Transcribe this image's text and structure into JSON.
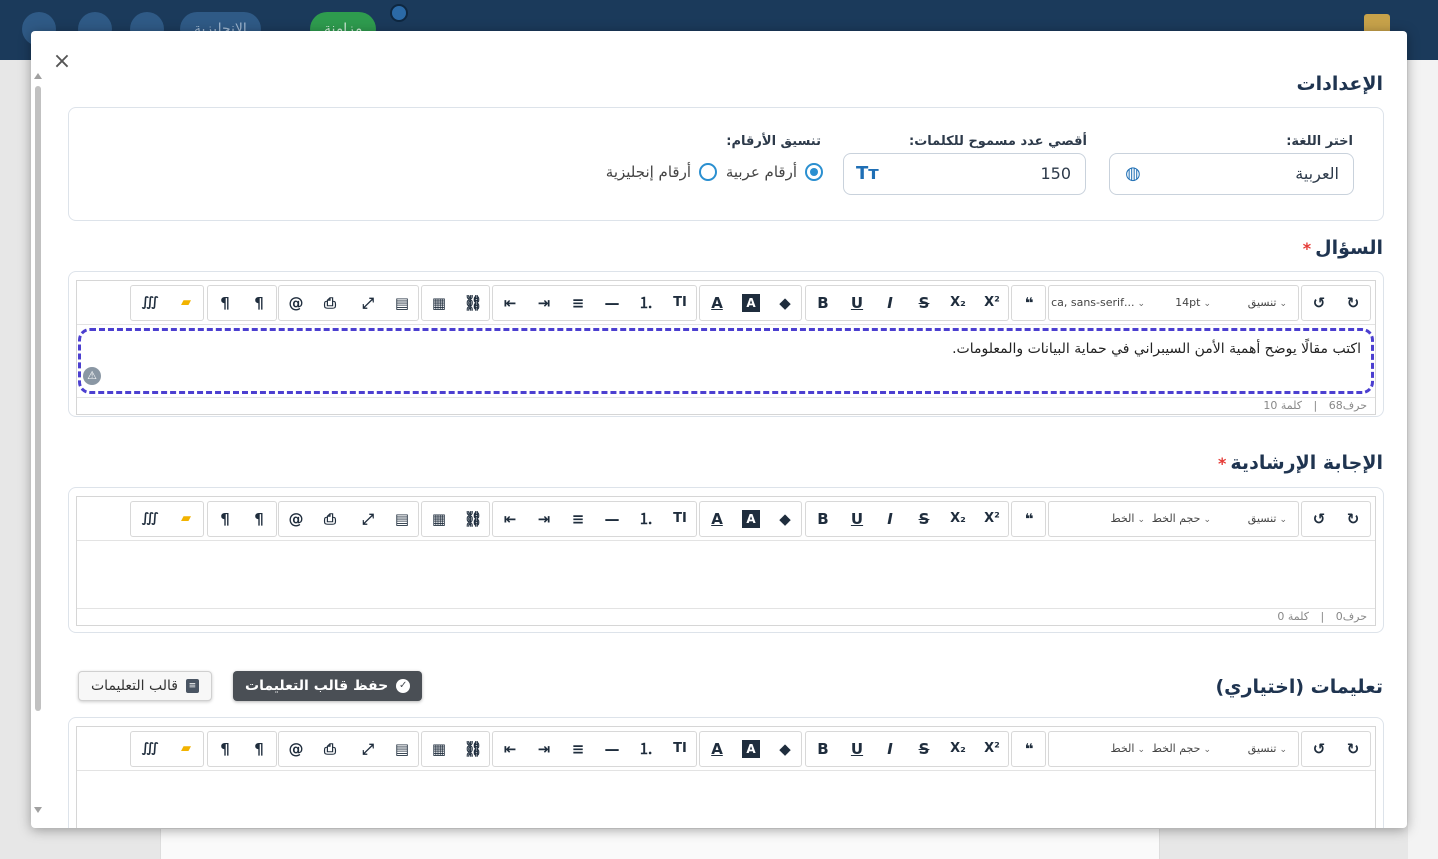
{
  "topbar": {
    "english_pill": "الإنجليزية",
    "sync_pill": "مزامنة"
  },
  "modal": {
    "close_icon": "×",
    "settings_title": "الإعدادات",
    "language": {
      "label": "اختر اللغة:",
      "value": "العربية"
    },
    "max_words": {
      "label": "أقصي عدد مسموح للكلمات:",
      "value": "150"
    },
    "number_format": {
      "label": "تنسيق الأرقام:",
      "options": [
        {
          "label": "أرقام عربية",
          "selected": true
        },
        {
          "label": "أرقام إنجليزية",
          "selected": false
        }
      ]
    },
    "question": {
      "title": "السؤال",
      "required_mark": "*",
      "font_select": "...ca, sans-serif",
      "size_select": "14pt",
      "format_select": "تنسيق",
      "content": "اكتب مقالًا يوضح أهمية الأمن السيبراني في حماية البيانات والمعلومات.",
      "char_count": "حرف68",
      "word_count": "كلمة 10"
    },
    "guide_answer": {
      "title": "الإجابة الإرشادية",
      "required_mark": "*",
      "font_select": "الخط",
      "size_select": "حجم الخط",
      "format_select": "تنسيق",
      "char_count": "حرف0",
      "word_count": "كلمة 0"
    },
    "instructions": {
      "title": "تعليمات (اختياري)",
      "save_template_button": "حفظ قالب التعليمات",
      "template_button": "قالب التعليمات",
      "font_select": "الخط",
      "size_select": "حجم الخط",
      "format_select": "تنسيق"
    },
    "status_separator": "|"
  },
  "toolbar_icons": {
    "special_chars": "∭",
    "folder": "▰",
    "ltr": "¶",
    "rtl": "¶",
    "mention": "@",
    "print": "⎙",
    "fullscreen": "⤢",
    "layout": "▤",
    "table": "▦",
    "link": "⛓",
    "outdent": "⇤",
    "indent": "⇥",
    "align": "≡",
    "hr": "—",
    "ordered_list": "⒈",
    "text_case": "TI",
    "font_color": "A",
    "bg_color": "A",
    "eraser": "◆",
    "bold": "B",
    "underline": "U",
    "italic": "I",
    "strike": "S",
    "subscript": "X₂",
    "superscript": "X²",
    "quote": "❝",
    "undo": "↺",
    "redo": "↻"
  },
  "colors": {
    "topbar": "#1b3a5b",
    "accent": "#1f6fb5",
    "dashed_focus": "#4c3fd0",
    "required": "#e53935"
  }
}
